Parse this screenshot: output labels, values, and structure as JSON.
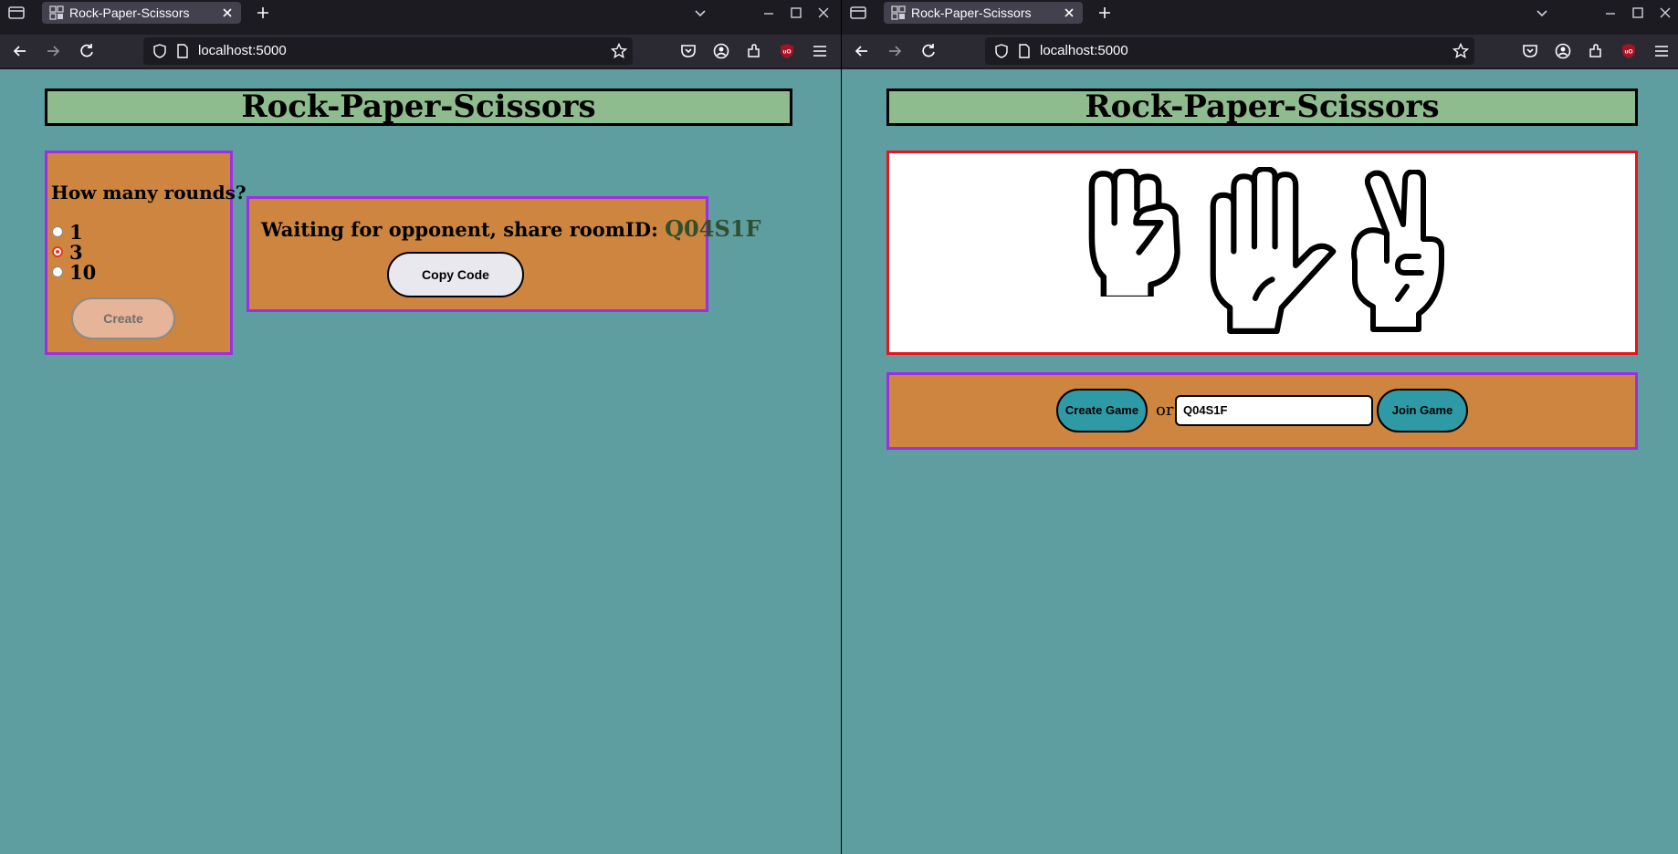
{
  "browser": {
    "tab_title": "Rock-Paper-Scissors",
    "url": "localhost:5000"
  },
  "left_page": {
    "heading": "Rock-Paper-Scissors",
    "rounds_question": "How many rounds?",
    "round_options": [
      {
        "label": "1",
        "checked": false
      },
      {
        "label": "3",
        "checked": true
      },
      {
        "label": "10",
        "checked": false
      }
    ],
    "create_label": "Create",
    "waiting_text": "Waiting for opponent, share roomID:",
    "room_id": "Q04S1F",
    "copy_label": "Copy Code"
  },
  "right_page": {
    "heading": "Rock-Paper-Scissors",
    "hands": [
      "rock-icon",
      "paper-icon",
      "scissors-icon"
    ],
    "create_game_label": "Create Game",
    "or_text": "or",
    "room_input_value": "Q04S1F",
    "join_game_label": "Join Game"
  },
  "colors": {
    "page_bg": "#5f9ea0",
    "title_bg": "#8fbc8f",
    "panel_bg": "#cd853f",
    "panel_border": "#9b30e0",
    "hands_border": "#e8141b",
    "teal_button": "#2e9aa6"
  }
}
